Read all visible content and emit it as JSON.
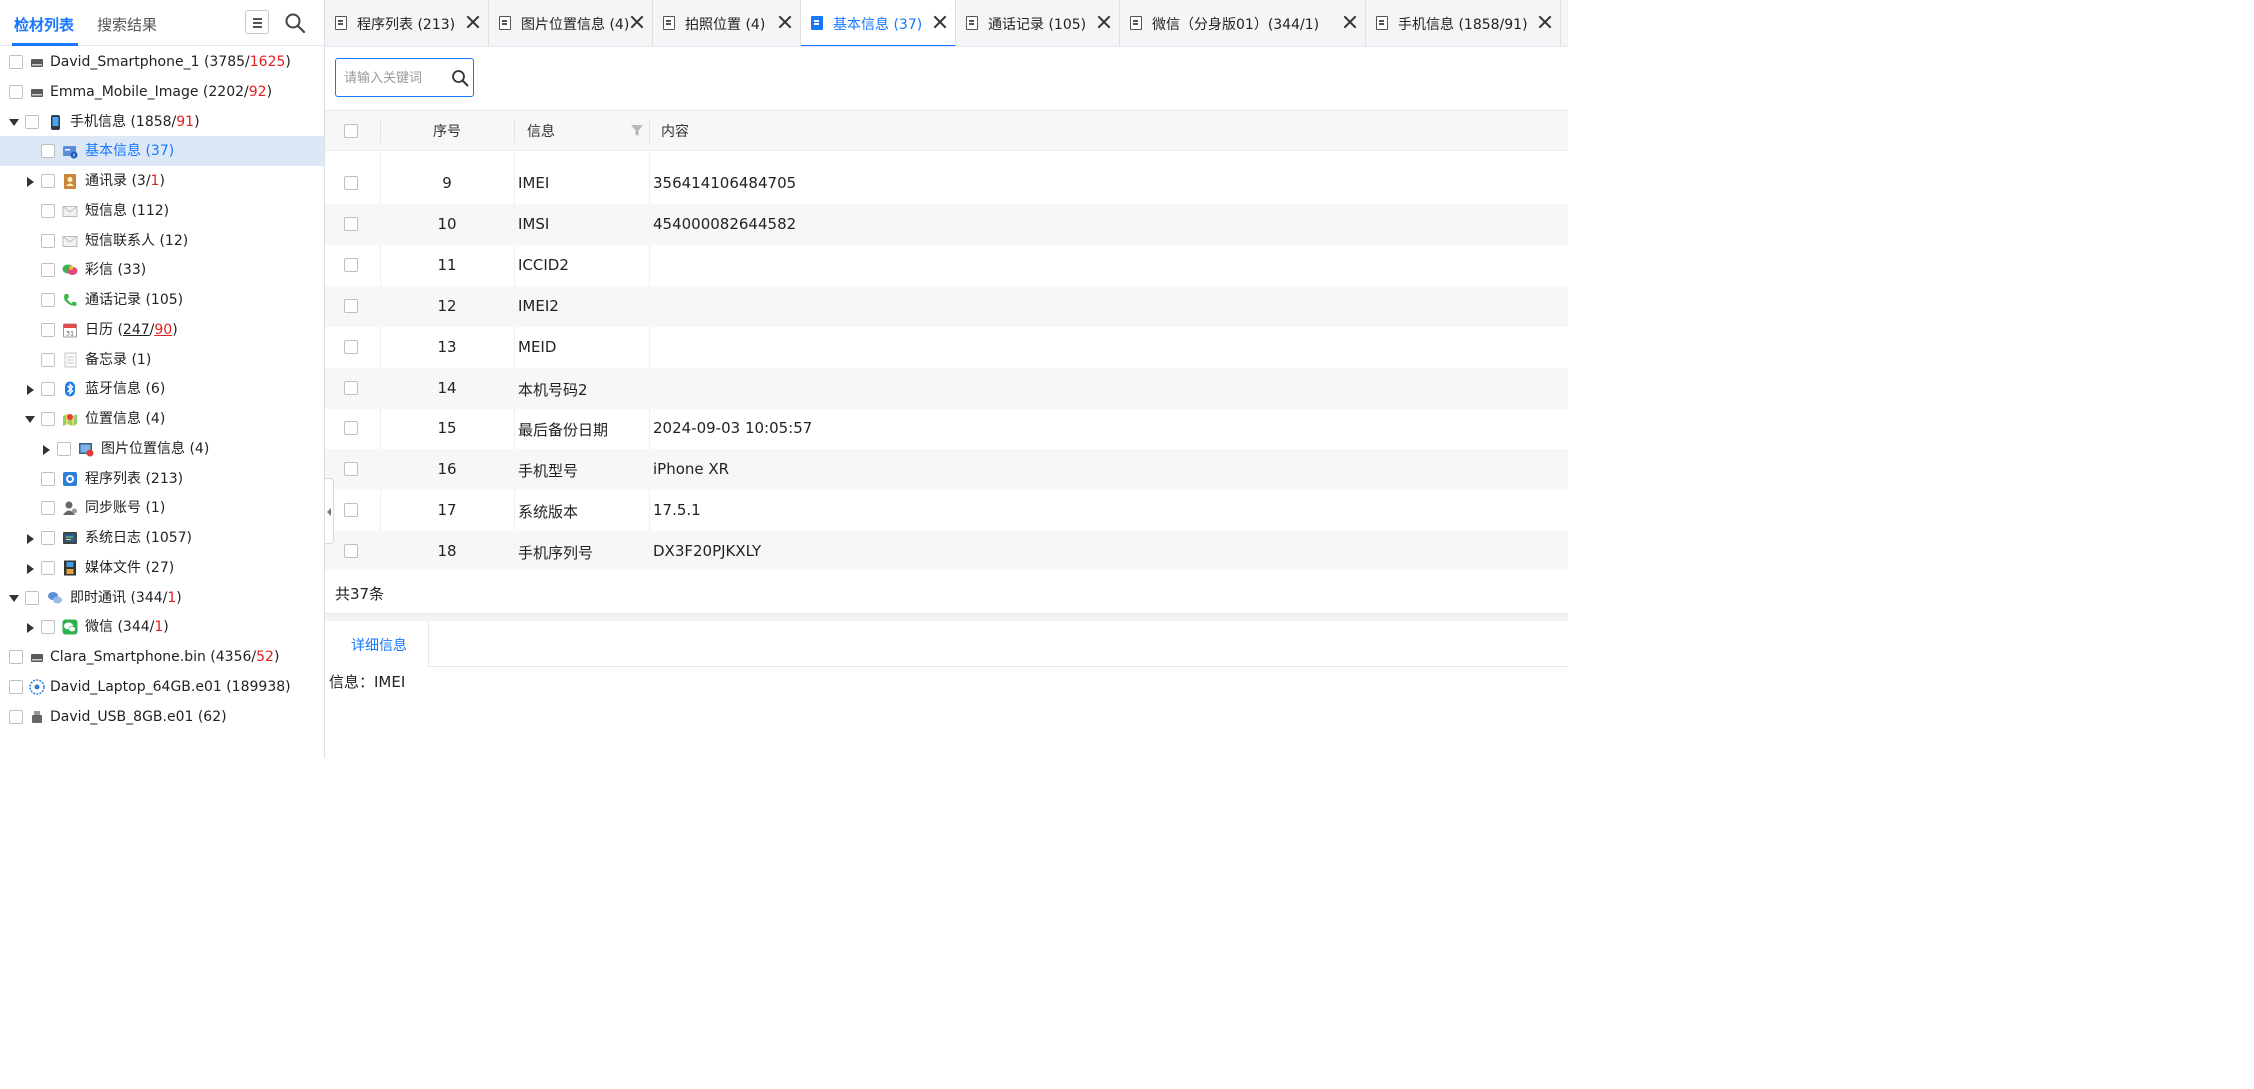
{
  "left_panel": {
    "tabs": [
      {
        "label": "检材列表",
        "active": true
      },
      {
        "label": "搜索结果",
        "active": false
      }
    ],
    "tree": [
      {
        "indent": 0,
        "caret": "none",
        "icon": "hard-drive-icon",
        "parts": [
          {
            "t": "David_Smartphone_1 (3785/"
          },
          {
            "t": "1625",
            "c": "red"
          },
          {
            "t": ")"
          }
        ]
      },
      {
        "indent": 0,
        "caret": "none",
        "icon": "hard-drive-icon",
        "parts": [
          {
            "t": "Emma_Mobile_Image (2202/"
          },
          {
            "t": "92",
            "c": "red"
          },
          {
            "t": ")"
          }
        ]
      },
      {
        "indent": 1,
        "caret": "down",
        "icon": "phone-icon",
        "parts": [
          {
            "t": "手机信息 (1858/"
          },
          {
            "t": "91",
            "c": "red"
          },
          {
            "t": ")"
          }
        ]
      },
      {
        "indent": 2,
        "caret": "none",
        "icon": "id-card-icon",
        "selected": true,
        "parts": [
          {
            "t": "基本信息 (37)",
            "c": "blue"
          }
        ]
      },
      {
        "indent": 2,
        "caret": "right",
        "icon": "contacts-icon",
        "parts": [
          {
            "t": "通讯录 (3/"
          },
          {
            "t": "1",
            "c": "red"
          },
          {
            "t": ")"
          }
        ]
      },
      {
        "indent": 2,
        "caret": "none",
        "icon": "envelope-icon",
        "parts": [
          {
            "t": "短信息 (112)"
          }
        ]
      },
      {
        "indent": 2,
        "caret": "none",
        "icon": "envelope-icon",
        "parts": [
          {
            "t": "短信联系人 (12)"
          }
        ]
      },
      {
        "indent": 2,
        "caret": "none",
        "icon": "mms-bubble-icon",
        "parts": [
          {
            "t": "彩信 (33)"
          }
        ]
      },
      {
        "indent": 2,
        "caret": "none",
        "icon": "phone-call-icon",
        "parts": [
          {
            "t": "通话记录 (105)"
          }
        ]
      },
      {
        "indent": 2,
        "caret": "none",
        "icon": "calendar-icon",
        "parts": [
          {
            "t": "日历 ("
          },
          {
            "t": "247",
            "c": "ul"
          },
          {
            "t": "/"
          },
          {
            "t": "90",
            "c": "red ul"
          },
          {
            "t": ")"
          }
        ]
      },
      {
        "indent": 2,
        "caret": "none",
        "icon": "memo-icon",
        "parts": [
          {
            "t": "备忘录 (1)"
          }
        ]
      },
      {
        "indent": 2,
        "caret": "right",
        "icon": "bluetooth-icon",
        "parts": [
          {
            "t": "蓝牙信息 (6)"
          }
        ]
      },
      {
        "indent": 2,
        "caret": "down",
        "icon": "map-location-icon",
        "parts": [
          {
            "t": "位置信息 (4)"
          }
        ]
      },
      {
        "indent": 3,
        "caret": "right",
        "icon": "photo-location-icon",
        "parts": [
          {
            "t": "图片位置信息 (4)"
          }
        ]
      },
      {
        "indent": 2,
        "caret": "none",
        "icon": "app-list-icon",
        "parts": [
          {
            "t": "程序列表 (213)"
          }
        ]
      },
      {
        "indent": 2,
        "caret": "none",
        "icon": "account-icon",
        "parts": [
          {
            "t": "同步账号 (1)"
          }
        ]
      },
      {
        "indent": 2,
        "caret": "right",
        "icon": "system-log-icon",
        "parts": [
          {
            "t": "系统日志 (1057)"
          }
        ]
      },
      {
        "indent": 2,
        "caret": "right",
        "icon": "film-icon",
        "parts": [
          {
            "t": "媒体文件 (27)"
          }
        ]
      },
      {
        "indent": 1,
        "caret": "down",
        "icon": "chat-bubbles-icon",
        "parts": [
          {
            "t": "即时通讯 (344/"
          },
          {
            "t": "1",
            "c": "red"
          },
          {
            "t": ")"
          }
        ]
      },
      {
        "indent": 2,
        "caret": "right",
        "icon": "wechat-icon",
        "parts": [
          {
            "t": "微信 (344/"
          },
          {
            "t": "1",
            "c": "red"
          },
          {
            "t": ")"
          }
        ]
      },
      {
        "indent": 0,
        "caret": "none",
        "icon": "hard-drive-icon",
        "parts": [
          {
            "t": "Clara_Smartphone.bin (4356/"
          },
          {
            "t": "52",
            "c": "red"
          },
          {
            "t": ")"
          }
        ]
      },
      {
        "indent": 0,
        "caret": "none",
        "icon": "disk-image-icon",
        "parts": [
          {
            "t": "David_Laptop_64GB.e01 (189938)"
          }
        ]
      },
      {
        "indent": 0,
        "caret": "none",
        "icon": "usb-drive-icon",
        "parts": [
          {
            "t": "David_USB_8GB.e01 (62)"
          }
        ]
      }
    ]
  },
  "tabs": [
    {
      "label": "程序列表 (213)",
      "active": false
    },
    {
      "label": "图片位置信息 (4)",
      "active": false
    },
    {
      "label": "拍照位置 (4)",
      "active": false
    },
    {
      "label": "基本信息 (37)",
      "active": true
    },
    {
      "label": "通话记录 (105)",
      "active": false
    },
    {
      "label": "微信（分身版01）(344/1)",
      "active": false
    },
    {
      "label": "手机信息 (1858/91)",
      "active": false
    }
  ],
  "search": {
    "placeholder": "请输入关键词",
    "value": ""
  },
  "table": {
    "columns": [
      "序号",
      "信息",
      "内容"
    ],
    "rows": [
      {
        "no": "9",
        "info": "IMEI",
        "content": "356414106484705"
      },
      {
        "no": "10",
        "info": "IMSI",
        "content": "454000082644582"
      },
      {
        "no": "11",
        "info": "ICCID2",
        "content": ""
      },
      {
        "no": "12",
        "info": "IMEI2",
        "content": ""
      },
      {
        "no": "13",
        "info": "MEID",
        "content": ""
      },
      {
        "no": "14",
        "info": "本机号码2",
        "content": ""
      },
      {
        "no": "15",
        "info": "最后备份日期",
        "content": "2024-09-03 10:05:57"
      },
      {
        "no": "16",
        "info": "手机型号",
        "content": "iPhone XR"
      },
      {
        "no": "17",
        "info": "系统版本",
        "content": "17.5.1"
      },
      {
        "no": "18",
        "info": "手机序列号",
        "content": "DX3F20PJKXLY"
      }
    ],
    "total_text": "共37条"
  },
  "detail": {
    "tab_label": "详细信息",
    "content_text": "信息：IMEI"
  },
  "colors": {
    "accent": "#1677ff",
    "red": "#e02020",
    "selected_row": "#dde8f6"
  }
}
